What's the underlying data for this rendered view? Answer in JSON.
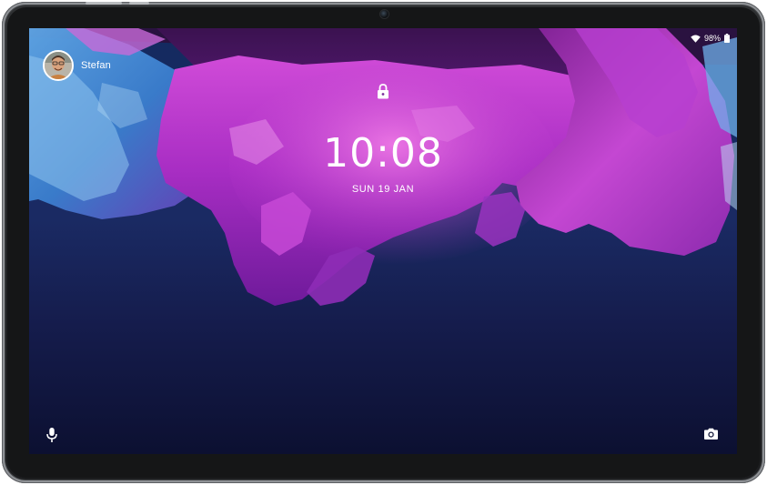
{
  "status_bar": {
    "battery": "98%",
    "icons": [
      "wifi-icon",
      "battery-icon"
    ]
  },
  "user": {
    "name": "Stefan"
  },
  "lock_screen": {
    "time": "10:08",
    "date": "SUN 19 JAN"
  },
  "shortcuts": {
    "left": "microphone-icon",
    "right": "camera-icon"
  },
  "colors": {
    "wallpaper_magenta": "#b235c9",
    "wallpaper_blue": "#1b2f6b",
    "device_frame": "#2a2c2e"
  }
}
